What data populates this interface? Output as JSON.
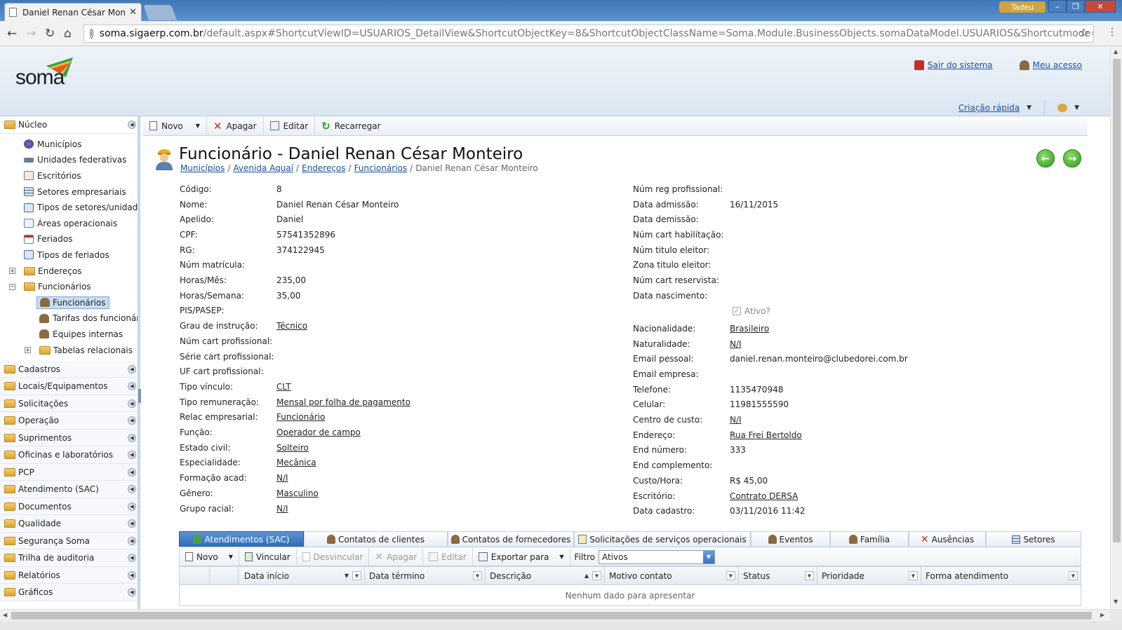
{
  "browser": {
    "tab_title": "Daniel Renan César Mon",
    "url_domain": "soma.sigaerp.com.br",
    "url_rest": "/default.aspx#ShortcutViewID=USUARIOS_DetailView&ShortcutObjectKey=8&ShortcutObjectClassName=Soma.Module.BusinessObjects.somaDataModel.USUARIOS&Shortcutmode=View",
    "user_badge": "Tadeu"
  },
  "header": {
    "logo": "soma",
    "exit_label": "Sair do sistema",
    "access_label": "Meu acesso",
    "quick_label": "Criação rápida"
  },
  "sidebar": {
    "top_group": "Núcleo",
    "tree": [
      {
        "label": "Municípios"
      },
      {
        "label": "Unidades federativas"
      },
      {
        "label": "Escritórios"
      },
      {
        "label": "Setores empresariais"
      },
      {
        "label": "Tipos de setores/unidades"
      },
      {
        "label": "Áreas operacionais"
      },
      {
        "label": "Feriados"
      },
      {
        "label": "Tipos de feriados"
      },
      {
        "label": "Endereços"
      },
      {
        "label": "Funcionários"
      },
      {
        "label": "Funcionários"
      },
      {
        "label": "Tarifas dos funcionário"
      },
      {
        "label": "Equipes internas"
      },
      {
        "label": "Tabelas relacionais"
      }
    ],
    "groups": [
      "Cadastros",
      "Locais/Equipamentos",
      "Solicitações",
      "Operação",
      "Suprimentos",
      "Oficinas e laboratórios",
      "PCP",
      "Atendimento (SAC)",
      "Documentos",
      "Qualidade",
      "Segurança Soma",
      "Trilha de auditoria",
      "Relatórios",
      "Gráficos"
    ]
  },
  "toolbar": {
    "new_label": "Novo",
    "delete_label": "Apagar",
    "edit_label": "Editar",
    "reload_label": "Recarregar"
  },
  "page": {
    "title": "Funcionário - Daniel Renan César Monteiro",
    "breadcrumb": [
      "Municípios",
      "Avenida Aquaí",
      "Endereços",
      "Funcionários"
    ],
    "breadcrumb_current": "Daniel Renan César Monteiro"
  },
  "fields_left": [
    {
      "label": "Código:",
      "value": "8",
      "link": false
    },
    {
      "label": "Nome:",
      "value": "Daniel Renan César Monteiro",
      "link": false
    },
    {
      "label": "Apelido:",
      "value": "Daniel",
      "link": false
    },
    {
      "label": "CPF:",
      "value": "57541352896",
      "link": false
    },
    {
      "label": "RG:",
      "value": "374122945",
      "link": false
    },
    {
      "label": "Núm matrícula:",
      "value": "",
      "link": false
    },
    {
      "label": "Horas/Mês:",
      "value": "235,00",
      "link": false
    },
    {
      "label": "Horas/Semana:",
      "value": "35,00",
      "link": false
    },
    {
      "label": "PIS/PASEP:",
      "value": "",
      "link": false
    },
    {
      "label": "Grau de instrução:",
      "value": "Técnico",
      "link": true
    },
    {
      "label": "Núm cart profissional:",
      "value": "",
      "link": false
    },
    {
      "label": "Série cart profissional:",
      "value": "",
      "link": false
    },
    {
      "label": "UF cart profissional:",
      "value": "",
      "link": false
    },
    {
      "label": "Tipo vínculo:",
      "value": "CLT",
      "link": true
    },
    {
      "label": "Tipo remuneração:",
      "value": "Mensal por folha de pagamento",
      "link": true
    },
    {
      "label": "Relac empresarial:",
      "value": "Funcionário",
      "link": true
    },
    {
      "label": "Função:",
      "value": "Operador de campo",
      "link": true
    },
    {
      "label": "Estado civil:",
      "value": "Solteiro",
      "link": true
    },
    {
      "label": "Especialidade:",
      "value": "Mecânica",
      "link": true
    },
    {
      "label": "Formação acad:",
      "value": "N/I",
      "link": true
    },
    {
      "label": "Gênero:",
      "value": "Masculino",
      "link": true
    },
    {
      "label": "Grupo racial:",
      "value": "N/I",
      "link": true
    }
  ],
  "fields_right_top": [
    {
      "label": "Núm reg profissional:",
      "value": "",
      "link": false
    },
    {
      "label": "Data admissão:",
      "value": "16/11/2015",
      "link": false
    },
    {
      "label": "Data demissão:",
      "value": "",
      "link": false
    },
    {
      "label": "Núm cart habilitação:",
      "value": "",
      "link": false
    },
    {
      "label": "Núm titulo eleitor:",
      "value": "",
      "link": false
    },
    {
      "label": "Zona titulo eleitor:",
      "value": "",
      "link": false
    },
    {
      "label": "Núm cart reservista:",
      "value": "",
      "link": false
    },
    {
      "label": "Data nascimento:",
      "value": "",
      "link": false
    }
  ],
  "ativo_label": "Ativo?",
  "fields_right_bottom": [
    {
      "label": "Nacionalidade:",
      "value": "Brasileiro",
      "link": true
    },
    {
      "label": "Naturalidade:",
      "value": "N/I",
      "link": true
    },
    {
      "label": "Email pessoal:",
      "value": "daniel.renan.monteiro@clubedorei.com.br",
      "link": false
    },
    {
      "label": "Email empresa:",
      "value": "",
      "link": false
    },
    {
      "label": "Telefone:",
      "value": "1135470948",
      "link": false
    },
    {
      "label": "Celular:",
      "value": "11981555590",
      "link": false
    },
    {
      "label": "Centro de custo:",
      "value": "N/I",
      "link": true
    },
    {
      "label": "Endereço:",
      "value": "Rua Frei Bertoldo",
      "link": true
    },
    {
      "label": "End número:",
      "value": "333",
      "link": false
    },
    {
      "label": "End complemento:",
      "value": "",
      "link": false
    },
    {
      "label": "Custo/Hora:",
      "value": "R$ 45,00",
      "link": false
    },
    {
      "label": "Escritório:",
      "value": "Contrato DERSA",
      "link": true
    },
    {
      "label": "Data cadastro:",
      "value": "03/11/2016 11:42",
      "link": false
    }
  ],
  "detail_tabs": [
    {
      "label": "Atendimentos (SAC)",
      "icon": "sac-icon",
      "active": true
    },
    {
      "label": "Contatos de clientes",
      "icon": "person-icon",
      "active": false
    },
    {
      "label": "Contatos de fornecedores",
      "icon": "person-icon",
      "active": false
    },
    {
      "label": "Solicitações de serviços operacionais",
      "icon": "document-icon",
      "active": false
    },
    {
      "label": "Eventos",
      "icon": "person-icon",
      "active": false
    },
    {
      "label": "Família",
      "icon": "person-icon",
      "active": false
    },
    {
      "label": "Ausências",
      "icon": "x-icon",
      "active": false
    },
    {
      "label": "Setores",
      "icon": "grid-icon",
      "active": false
    }
  ],
  "subtoolbar": {
    "new_label": "Novo",
    "link_label": "Vincular",
    "unlink_label": "Desvincular",
    "delete_label": "Apagar",
    "edit_label": "Editar",
    "export_label": "Exportar para",
    "filter_label": "Filtro",
    "filter_value": "Ativos"
  },
  "grid": {
    "columns": [
      "Data início",
      "Data término",
      "Descrição",
      "Motivo contato",
      "Status",
      "Prioridade",
      "Forma atendimento"
    ],
    "empty_text": "Nenhum dado para apresentar"
  }
}
